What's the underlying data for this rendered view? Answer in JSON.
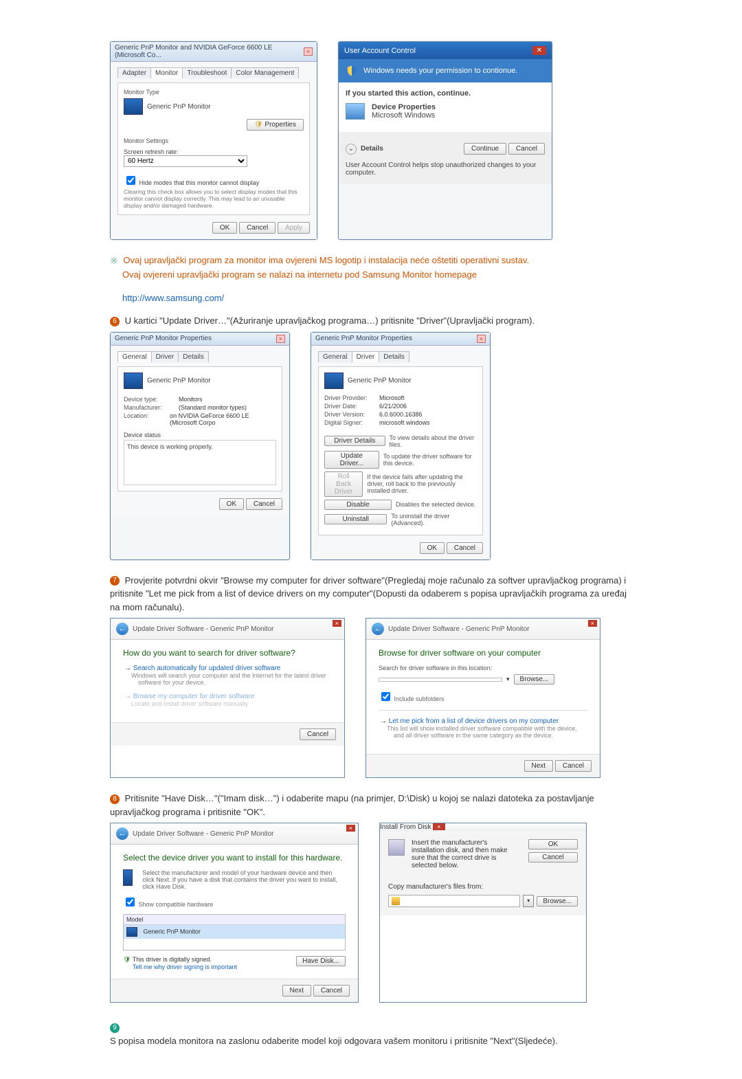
{
  "dlg1": {
    "title": "Generic PnP Monitor and NVIDIA GeForce 6600 LE (Microsoft Co...",
    "tabs": [
      "Adapter",
      "Monitor",
      "Troubleshoot",
      "Color Management"
    ],
    "active_tab": "Monitor",
    "mon_type_lbl": "Monitor Type",
    "mon_type_val": "Generic PnP Monitor",
    "properties_btn": "Properties",
    "mon_settings_lbl": "Monitor Settings",
    "refresh_lbl": "Screen refresh rate:",
    "refresh_val": "60 Hertz",
    "hide_modes_chk": "Hide modes that this monitor cannot display",
    "hide_modes_desc": "Clearing this check box allows you to select display modes that this monitor cannot display correctly. This may lead to an unusable display and/or damaged hardware.",
    "ok": "OK",
    "cancel": "Cancel",
    "apply": "Apply"
  },
  "uac": {
    "title_small": "User Account Control",
    "headline": "Windows needs your permission to contionue.",
    "started": "If you started this action, continue.",
    "prog_name": "Device Properties",
    "publisher": "Microsoft Windows",
    "details": "Details",
    "continue": "Continue",
    "cancel": "Cancel",
    "footer": "User Account Control helps stop unauthorized changes to your computer."
  },
  "step5": {
    "line1": "Ovaj upravljački program za monitor ima ovjereni MS logotip i instalacija neće oštetiti operativni sustav.",
    "line2a": "Ovaj ovjereni upravljački program se nalazi na internetu pod ",
    "line2b": "Samsung Monitor homepage",
    "url": "http://www.samsung.com/"
  },
  "step6": {
    "text": "U kartici \"Update Driver…\"(Ažuriranje upravljačkog programa…) pritisnite \"Driver\"(Upravljački program)."
  },
  "prop1": {
    "title": "Generic PnP Monitor Properties",
    "tabs": [
      "General",
      "Driver",
      "Details"
    ],
    "active": "General",
    "name": "Generic PnP Monitor",
    "k1": "Device type:",
    "v1": "Monitors",
    "k2": "Manufacturer:",
    "v2": "(Standard monitor types)",
    "k3": "Location:",
    "v3": "on NVIDIA GeForce 6600 LE (Microsoft Corpo",
    "status_lbl": "Device status",
    "status_txt": "This device is working properly.",
    "ok": "OK",
    "cancel": "Cancel"
  },
  "prop2": {
    "title": "Generic PnP Monitor Properties",
    "tabs": [
      "General",
      "Driver",
      "Details"
    ],
    "active": "Driver",
    "name": "Generic PnP Monitor",
    "k1": "Driver Provider:",
    "v1": "Microsoft",
    "k2": "Driver Date:",
    "v2": "6/21/2006",
    "k3": "Driver Version:",
    "v3": "6.0.6000.16386",
    "k4": "Digital Signer:",
    "v4": "microsoft windows",
    "b1": "Driver Details",
    "d1": "To view details about the driver files.",
    "b2": "Update Driver...",
    "d2": "To update the driver software for this device.",
    "b3": "Roll Back Driver",
    "d3": "If the device fails after updating the driver, roll back to the previously installed driver.",
    "b4": "Disable",
    "d4": "Disables the selected device.",
    "b5": "Uninstall",
    "d5": "To uninstall the driver (Advanced).",
    "ok": "OK",
    "cancel": "Cancel"
  },
  "step7": {
    "text": "Provjerite potvrdni okvir \"Browse my computer for driver software\"(Pregledaj moje računalo za softver upravljačkog programa) i pritisnite \"Let me pick from a list of device drivers on my computer\"(Dopusti da odaberem s popisa upravljačkih programa za uređaj na mom računalu)."
  },
  "wiz1": {
    "crumb": "Update Driver Software - Generic PnP Monitor",
    "q": "How do you want to search for driver software?",
    "o1t": "Search automatically for updated driver software",
    "o1d": "Windows will search your computer and the Internet for the latest driver software for your device.",
    "o2t": "Browse my computer for driver software",
    "o2d": "Locate and install driver software manually.",
    "cancel": "Cancel"
  },
  "wiz2": {
    "crumb": "Update Driver Software - Generic PnP Monitor",
    "q": "Browse for driver software on your computer",
    "loc_lbl": "Search for driver software in this location:",
    "path": "",
    "browse": "Browse...",
    "sub_chk": "Include subfolders",
    "o1t": "Let me pick from a list of device drivers on my computer",
    "o1d": "This list will show installed driver software compatible with the device, and all driver software in the same category as the device.",
    "next": "Next",
    "cancel": "Cancel"
  },
  "step8": {
    "text": "Pritisnite \"Have Disk…\"(\"Imam disk…\") i odaberite mapu (na primjer, D:\\Disk) u kojoj se nalazi datoteka za postavljanje upravljačkog programa i pritisnite \"OK\"."
  },
  "wiz3": {
    "crumb": "Update Driver Software - Generic PnP Monitor",
    "q": "Select the device driver you want to install for this hardware.",
    "desc": "Select the manufacturer and model of your hardware device and then click Next. If you have a disk that contains the driver you want to install, click Have Disk.",
    "compat_chk": "Show compatible hardware",
    "model_hdr": "Model",
    "model_item": "Generic PnP Monitor",
    "signed": "This driver is digitally signed.",
    "tell": "Tell me why driver signing is important",
    "have": "Have Disk...",
    "next": "Next",
    "cancel": "Cancel"
  },
  "ifd": {
    "title": "Install From Disk",
    "msg": "Insert the manufacturer's installation disk, and then make sure that the correct drive is selected below.",
    "ok": "OK",
    "cancel": "Cancel",
    "copy_lbl": "Copy manufacturer's files from:",
    "path": "",
    "browse": "Browse..."
  },
  "step9": {
    "text": "S popisa modela monitora na zaslonu odaberite model koji odgovara vašem monitoru i pritisnite \"Next\"(Sljedeće)."
  }
}
